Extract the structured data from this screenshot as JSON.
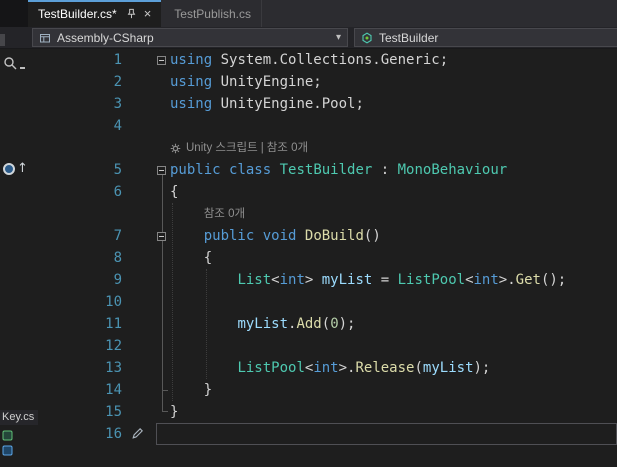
{
  "colors": {
    "bg": "#1e1e1e",
    "chrome-well": "#2c2c30",
    "chrome-box": "#333338",
    "chrome-border": "#48484d",
    "accent": "#5c9fd8",
    "tab-active-text": "#ffffff",
    "tab-inactive-text": "#9a9a9a",
    "kw": "#569cd6",
    "type": "#4ec9b0",
    "method": "#dcdcaa",
    "variable": "#9cdcfe",
    "number": "#b5cea8",
    "pl": "#d4d4d4",
    "linenum": "#4b93b2",
    "lens": "#8f8f8f"
  },
  "tab_bar": {
    "tabs": [
      {
        "label": "TestBuilder.cs*",
        "active": true
      },
      {
        "label": "TestPublish.cs",
        "active": false
      }
    ],
    "close_icon": "×"
  },
  "nav_bar": {
    "project": {
      "label": "Assembly-CSharp",
      "dropdown_icon": "▾"
    },
    "type": {
      "label": "TestBuilder"
    }
  },
  "left_rail": {
    "file_fragment": "Key.cs"
  },
  "editor": {
    "caret_line": "16",
    "glyphs": {
      "up_arrow": "↑"
    },
    "codelens": {
      "unity_label": "Unity 스크립트",
      "separator": "|",
      "references": "참조 0개"
    },
    "rows": [
      {
        "kind": "code",
        "num": "1",
        "fold": true,
        "tokens": [
          [
            "kw",
            "using"
          ],
          [
            "pl",
            " System.Collections.Generic;"
          ]
        ]
      },
      {
        "kind": "code",
        "num": "2",
        "tokens": [
          [
            "kw",
            "using"
          ],
          [
            "pl",
            " UnityEngine;"
          ]
        ]
      },
      {
        "kind": "code",
        "num": "3",
        "tokens": [
          [
            "kw",
            "using"
          ],
          [
            "pl",
            " UnityEngine.Pool;"
          ]
        ]
      },
      {
        "kind": "code",
        "num": "4",
        "tokens": []
      },
      {
        "kind": "lens",
        "indent_ch": 0,
        "unity_icon": true
      },
      {
        "kind": "code",
        "num": "5",
        "fold": true,
        "tokens": [
          [
            "kw",
            "public"
          ],
          [
            "pl",
            " "
          ],
          [
            "kw",
            "class"
          ],
          [
            "pl",
            " "
          ],
          [
            "type",
            "TestBuilder"
          ],
          [
            "pl",
            " : "
          ],
          [
            "type",
            "MonoBehaviour"
          ]
        ]
      },
      {
        "kind": "code",
        "num": "6",
        "tokens": [
          [
            "pl",
            "{"
          ]
        ]
      },
      {
        "kind": "lens",
        "indent_ch": 4
      },
      {
        "kind": "code",
        "num": "7",
        "fold": true,
        "tokens": [
          [
            "pl",
            "    "
          ],
          [
            "kw",
            "public"
          ],
          [
            "pl",
            " "
          ],
          [
            "kw",
            "void"
          ],
          [
            "pl",
            " "
          ],
          [
            "method",
            "DoBuild"
          ],
          [
            "pl",
            "()"
          ]
        ]
      },
      {
        "kind": "code",
        "num": "8",
        "tokens": [
          [
            "pl",
            "    {"
          ]
        ]
      },
      {
        "kind": "code",
        "num": "9",
        "tokens": [
          [
            "pl",
            "        "
          ],
          [
            "type",
            "List"
          ],
          [
            "pl",
            "<"
          ],
          [
            "kw",
            "int"
          ],
          [
            "pl",
            "> "
          ],
          [
            "variable",
            "myList"
          ],
          [
            "pl",
            " = "
          ],
          [
            "type",
            "ListPool"
          ],
          [
            "pl",
            "<"
          ],
          [
            "kw",
            "int"
          ],
          [
            "pl",
            ">."
          ],
          [
            "method",
            "Get"
          ],
          [
            "pl",
            "();"
          ]
        ]
      },
      {
        "kind": "code",
        "num": "10",
        "tokens": []
      },
      {
        "kind": "code",
        "num": "11",
        "tokens": [
          [
            "pl",
            "        "
          ],
          [
            "variable",
            "myList"
          ],
          [
            "pl",
            "."
          ],
          [
            "method",
            "Add"
          ],
          [
            "pl",
            "("
          ],
          [
            "number",
            "0"
          ],
          [
            "pl",
            ");"
          ]
        ]
      },
      {
        "kind": "code",
        "num": "12",
        "tokens": []
      },
      {
        "kind": "code",
        "num": "13",
        "tokens": [
          [
            "pl",
            "        "
          ],
          [
            "type",
            "ListPool"
          ],
          [
            "pl",
            "<"
          ],
          [
            "kw",
            "int"
          ],
          [
            "pl",
            ">."
          ],
          [
            "method",
            "Release"
          ],
          [
            "pl",
            "("
          ],
          [
            "variable",
            "myList"
          ],
          [
            "pl",
            ");"
          ]
        ]
      },
      {
        "kind": "code",
        "num": "14",
        "tokens": [
          [
            "pl",
            "    }"
          ]
        ]
      },
      {
        "kind": "code",
        "num": "15",
        "tokens": [
          [
            "pl",
            "}"
          ]
        ]
      },
      {
        "kind": "code",
        "num": "16",
        "pencil": true,
        "tokens": []
      }
    ]
  }
}
